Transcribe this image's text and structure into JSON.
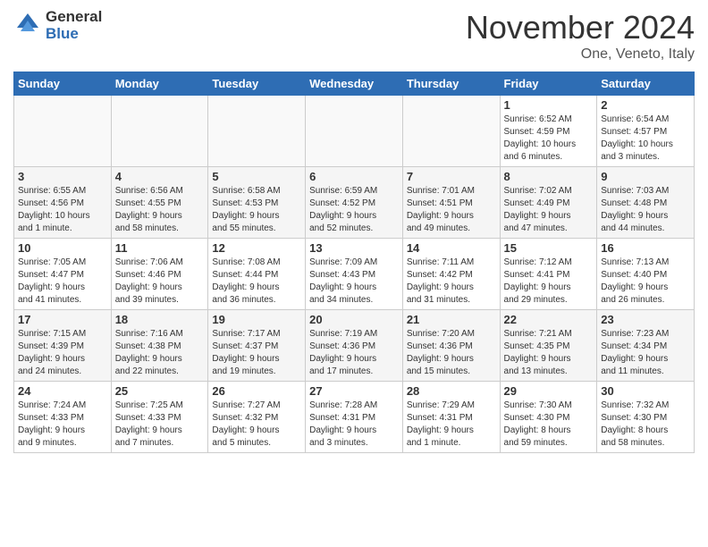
{
  "header": {
    "logo_general": "General",
    "logo_blue": "Blue",
    "month_title": "November 2024",
    "location": "One, Veneto, Italy"
  },
  "weekdays": [
    "Sunday",
    "Monday",
    "Tuesday",
    "Wednesday",
    "Thursday",
    "Friday",
    "Saturday"
  ],
  "weeks": [
    [
      {
        "day": "",
        "info": ""
      },
      {
        "day": "",
        "info": ""
      },
      {
        "day": "",
        "info": ""
      },
      {
        "day": "",
        "info": ""
      },
      {
        "day": "",
        "info": ""
      },
      {
        "day": "1",
        "info": "Sunrise: 6:52 AM\nSunset: 4:59 PM\nDaylight: 10 hours\nand 6 minutes."
      },
      {
        "day": "2",
        "info": "Sunrise: 6:54 AM\nSunset: 4:57 PM\nDaylight: 10 hours\nand 3 minutes."
      }
    ],
    [
      {
        "day": "3",
        "info": "Sunrise: 6:55 AM\nSunset: 4:56 PM\nDaylight: 10 hours\nand 1 minute."
      },
      {
        "day": "4",
        "info": "Sunrise: 6:56 AM\nSunset: 4:55 PM\nDaylight: 9 hours\nand 58 minutes."
      },
      {
        "day": "5",
        "info": "Sunrise: 6:58 AM\nSunset: 4:53 PM\nDaylight: 9 hours\nand 55 minutes."
      },
      {
        "day": "6",
        "info": "Sunrise: 6:59 AM\nSunset: 4:52 PM\nDaylight: 9 hours\nand 52 minutes."
      },
      {
        "day": "7",
        "info": "Sunrise: 7:01 AM\nSunset: 4:51 PM\nDaylight: 9 hours\nand 49 minutes."
      },
      {
        "day": "8",
        "info": "Sunrise: 7:02 AM\nSunset: 4:49 PM\nDaylight: 9 hours\nand 47 minutes."
      },
      {
        "day": "9",
        "info": "Sunrise: 7:03 AM\nSunset: 4:48 PM\nDaylight: 9 hours\nand 44 minutes."
      }
    ],
    [
      {
        "day": "10",
        "info": "Sunrise: 7:05 AM\nSunset: 4:47 PM\nDaylight: 9 hours\nand 41 minutes."
      },
      {
        "day": "11",
        "info": "Sunrise: 7:06 AM\nSunset: 4:46 PM\nDaylight: 9 hours\nand 39 minutes."
      },
      {
        "day": "12",
        "info": "Sunrise: 7:08 AM\nSunset: 4:44 PM\nDaylight: 9 hours\nand 36 minutes."
      },
      {
        "day": "13",
        "info": "Sunrise: 7:09 AM\nSunset: 4:43 PM\nDaylight: 9 hours\nand 34 minutes."
      },
      {
        "day": "14",
        "info": "Sunrise: 7:11 AM\nSunset: 4:42 PM\nDaylight: 9 hours\nand 31 minutes."
      },
      {
        "day": "15",
        "info": "Sunrise: 7:12 AM\nSunset: 4:41 PM\nDaylight: 9 hours\nand 29 minutes."
      },
      {
        "day": "16",
        "info": "Sunrise: 7:13 AM\nSunset: 4:40 PM\nDaylight: 9 hours\nand 26 minutes."
      }
    ],
    [
      {
        "day": "17",
        "info": "Sunrise: 7:15 AM\nSunset: 4:39 PM\nDaylight: 9 hours\nand 24 minutes."
      },
      {
        "day": "18",
        "info": "Sunrise: 7:16 AM\nSunset: 4:38 PM\nDaylight: 9 hours\nand 22 minutes."
      },
      {
        "day": "19",
        "info": "Sunrise: 7:17 AM\nSunset: 4:37 PM\nDaylight: 9 hours\nand 19 minutes."
      },
      {
        "day": "20",
        "info": "Sunrise: 7:19 AM\nSunset: 4:36 PM\nDaylight: 9 hours\nand 17 minutes."
      },
      {
        "day": "21",
        "info": "Sunrise: 7:20 AM\nSunset: 4:36 PM\nDaylight: 9 hours\nand 15 minutes."
      },
      {
        "day": "22",
        "info": "Sunrise: 7:21 AM\nSunset: 4:35 PM\nDaylight: 9 hours\nand 13 minutes."
      },
      {
        "day": "23",
        "info": "Sunrise: 7:23 AM\nSunset: 4:34 PM\nDaylight: 9 hours\nand 11 minutes."
      }
    ],
    [
      {
        "day": "24",
        "info": "Sunrise: 7:24 AM\nSunset: 4:33 PM\nDaylight: 9 hours\nand 9 minutes."
      },
      {
        "day": "25",
        "info": "Sunrise: 7:25 AM\nSunset: 4:33 PM\nDaylight: 9 hours\nand 7 minutes."
      },
      {
        "day": "26",
        "info": "Sunrise: 7:27 AM\nSunset: 4:32 PM\nDaylight: 9 hours\nand 5 minutes."
      },
      {
        "day": "27",
        "info": "Sunrise: 7:28 AM\nSunset: 4:31 PM\nDaylight: 9 hours\nand 3 minutes."
      },
      {
        "day": "28",
        "info": "Sunrise: 7:29 AM\nSunset: 4:31 PM\nDaylight: 9 hours\nand 1 minute."
      },
      {
        "day": "29",
        "info": "Sunrise: 7:30 AM\nSunset: 4:30 PM\nDaylight: 8 hours\nand 59 minutes."
      },
      {
        "day": "30",
        "info": "Sunrise: 7:32 AM\nSunset: 4:30 PM\nDaylight: 8 hours\nand 58 minutes."
      }
    ]
  ]
}
